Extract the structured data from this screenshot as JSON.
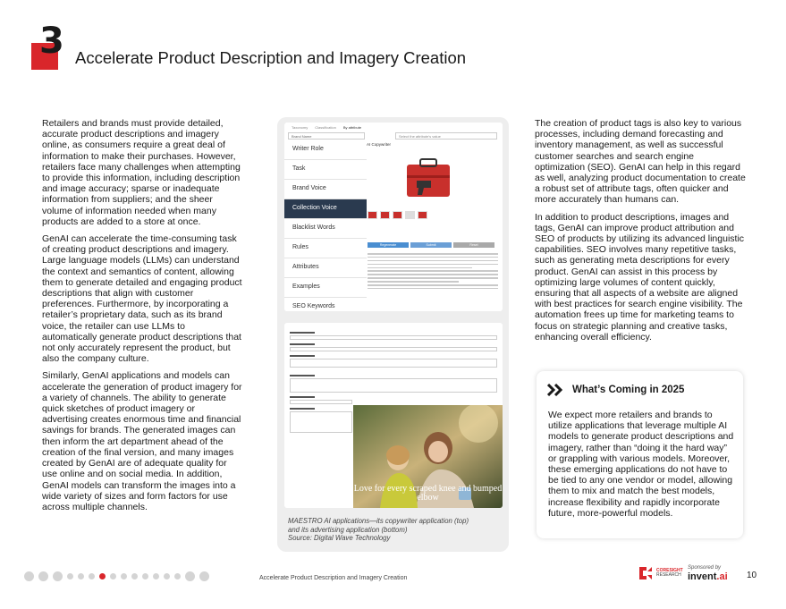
{
  "header": {
    "section_number": "3",
    "title": "Accelerate Product Description and Imagery Creation"
  },
  "left_column": {
    "paragraphs": [
      "Retailers and brands must provide detailed, accurate product descriptions and imagery online, as consumers require a great deal of information to make their purchases. However, retailers face many challenges when attempting to provide this information, including description and image accuracy; sparse or inadequate information from suppliers; and the sheer volume of information needed when many products are added to a store at once.",
      "GenAI can accelerate the time-consuming task of creating product descriptions and imagery. Large language models (LLMs) can understand the context and semantics of content, allowing them to generate detailed and engaging product descriptions that align with customer preferences. Furthermore, by incorporating a retailer’s proprietary data, such as its brand voice, the retailer can use LLMs to automatically generate product descriptions that not only accurately represent the product, but also the company culture.",
      "Similarly, GenAI applications and models can accelerate the generation of product imagery for a variety of channels. The ability to generate quick sketches of product imagery or advertising creates enormous time and financial savings for brands. The generated images can then inform the art department ahead of the creation of the final version, and many images created by GenAI are of adequate quality for use online and on social media. In addition, GenAI models can transform the images into a wide variety of sizes and form factors for use across multiple channels."
    ]
  },
  "figure": {
    "top_screenshot": {
      "tabs": [
        "Taxonomy",
        "Classification",
        "By attribute"
      ],
      "brand_field": "Brand Name",
      "attribute_placeholder": "Select the attribute's value",
      "menu": [
        "Writer Role",
        "Task",
        "Brand Voice",
        "Collection Voice",
        "Blacklist Words",
        "Rules",
        "Attributes",
        "Examples",
        "SEO Keywords"
      ],
      "active_menu": "Collection Voice",
      "ai_label": "AI Copywriter",
      "buttons": [
        "Regenerate",
        "Submit",
        "Reset"
      ]
    },
    "image_caption": "Love for every scraped knee and bumped elbow",
    "caption_lines": [
      "MAESTRO AI applications—its copywriter application (top)",
      "and its advertising application (bottom)",
      "Source: Digital Wave Technology"
    ]
  },
  "right_column": {
    "paragraphs": [
      "The creation of product tags is also key to various processes, including demand forecasting and inventory management, as well as successful customer searches and search engine optimization (SEO). GenAI can help in this regard as well, analyzing product documentation to create a robust set of attribute tags, often quicker and more accurately than humans can.",
      "In addition to product descriptions, images and tags, GenAI can improve product attribution and SEO of products by utilizing its advanced linguistic capabilities. SEO involves many repetitive tasks, such as generating meta descriptions for every product. GenAI can assist in this process by optimizing large volumes of content quickly, ensuring that all aspects of a website are aligned with best practices for search engine visibility. The automation frees up time for marketing teams to focus on strategic planning and creative tasks, enhancing overall efficiency."
    ]
  },
  "coming_box": {
    "title": "What’s Coming in 2025",
    "body": "We expect more retailers and brands to utilize applications that leverage multiple AI models to generate product descriptions and imagery, rather than “doing it the hard way” or grappling with various models. Moreover, these emerging applications do not have to be tied to any one vendor or model, allowing them to mix and match the best models, increase flexibility and rapidly incorporate future, more-powerful models."
  },
  "footer": {
    "text": "Accelerate Product Description and Imagery Creation",
    "coresight_line1": "CORESIGHT",
    "coresight_line2": "RESEARCH",
    "sponsored_label": "Sponsored by",
    "sponsor_name": "invent",
    "sponsor_suffix": ".ai",
    "page_number": "10",
    "nav_dots_total": 16,
    "nav_dots_active": 6
  },
  "colors": {
    "brand_red": "#d9262b",
    "menu_active": "#2a3a4f"
  }
}
